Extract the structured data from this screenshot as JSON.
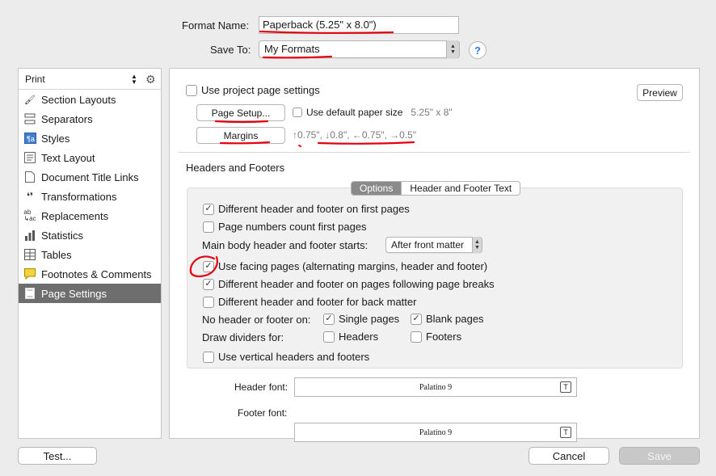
{
  "format_name": {
    "label": "Format Name:",
    "value": "Paperback (5.25\" x 8.0\")"
  },
  "save_to": {
    "label": "Save To:",
    "value": "My Formats"
  },
  "help": "?",
  "sidebar": {
    "header": "Print",
    "items": [
      {
        "label": "Section Layouts",
        "icon": "brush-icon"
      },
      {
        "label": "Separators",
        "icon": "separators-icon"
      },
      {
        "label": "Styles",
        "icon": "styles-icon"
      },
      {
        "label": "Text Layout",
        "icon": "text-layout-icon"
      },
      {
        "label": "Document Title Links",
        "icon": "document-icon"
      },
      {
        "label": "Transformations",
        "icon": "transformations-icon"
      },
      {
        "label": "Replacements",
        "icon": "replacements-icon"
      },
      {
        "label": "Statistics",
        "icon": "statistics-icon"
      },
      {
        "label": "Tables",
        "icon": "tables-icon"
      },
      {
        "label": "Footnotes & Comments",
        "icon": "footnotes-icon"
      },
      {
        "label": "Page Settings",
        "icon": "page-settings-icon"
      }
    ],
    "selected": "Page Settings"
  },
  "page": {
    "use_project_settings": {
      "label": "Use project page settings",
      "checked": false
    },
    "preview_button": "Preview",
    "page_setup_button": "Page Setup...",
    "use_default_paper": {
      "label": "Use default paper size",
      "checked": false
    },
    "paper_size": "5.25\" x 8\"",
    "margins_button": "Margins",
    "margins_value": "↑0.75\", ↓0.8\", ←0.75\", →0.5\"",
    "section_title": "Headers and Footers",
    "tabs": [
      "Options",
      "Header and Footer Text"
    ],
    "active_tab": "Options",
    "options": {
      "different_first": {
        "label": "Different header and footer on first pages",
        "checked": true
      },
      "page_numbers_count_first": {
        "label": "Page numbers count first pages",
        "checked": false
      },
      "main_body_starts_label": "Main body header and footer starts:",
      "main_body_starts_value": "After front matter",
      "use_facing": {
        "label": "Use facing pages (alternating margins, header and footer)",
        "checked": true
      },
      "different_following_breaks": {
        "label": "Different header and footer on pages following page breaks",
        "checked": true
      },
      "different_back_matter": {
        "label": "Different header and footer for back matter",
        "checked": false
      },
      "no_header_label": "No header or footer on:",
      "single_pages": {
        "label": "Single pages",
        "checked": true
      },
      "blank_pages": {
        "label": "Blank pages",
        "checked": true
      },
      "draw_dividers_label": "Draw dividers for:",
      "headers": {
        "label": "Headers",
        "checked": false
      },
      "footers": {
        "label": "Footers",
        "checked": false
      },
      "vertical_headers": {
        "label": "Use vertical headers and footers",
        "checked": false
      }
    },
    "header_font": {
      "label": "Header font:",
      "value": "Palatino 9"
    },
    "footer_font": {
      "label": "Footer font:",
      "value": "Palatino 9"
    }
  },
  "footer": {
    "test_button": "Test...",
    "cancel_button": "Cancel",
    "save_button": "Save"
  },
  "colors": {
    "annotation": "#e3000f",
    "selected_row": "#6e6e6e",
    "help_accent": "#2e7bf6"
  }
}
